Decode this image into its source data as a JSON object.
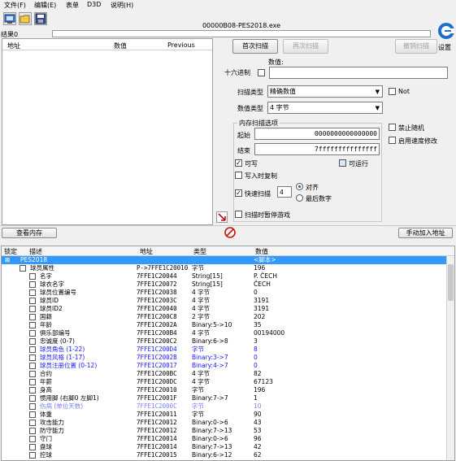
{
  "menu": {
    "file": "文件(F)",
    "edit": "编辑(E)",
    "table": "表单",
    "d3d": "D3D",
    "help": "说明(H)"
  },
  "process_title": "00000B08-PES2018.exe",
  "settings_label": "设置",
  "result_count": "结果0",
  "results_header": {
    "address": "地址",
    "value": "数值",
    "previous": "Previous"
  },
  "buttons": {
    "first_scan": "首次扫描",
    "next_scan": "再次扫描",
    "undo_scan": "撤销扫描",
    "view_memory": "查看内存",
    "add_address": "手动加入地址"
  },
  "scan": {
    "value_label": "数值:",
    "hex_label": "十六进制",
    "scan_type_label": "扫描类型",
    "scan_type_value": "精确数值",
    "not_label": "Not",
    "value_type_label": "数值类型",
    "value_type_value": "4 字节",
    "memory_options_title": "内存扫描选项",
    "start_label": "起始",
    "start_value": "0000000000000000",
    "end_label": "结束",
    "end_value": "7fffffffffffffff",
    "writable_label": "可写",
    "executable_label": "可运行",
    "copy_on_write_label": "写入时复制",
    "fast_scan_label": "快速扫描",
    "fast_scan_value": "4",
    "align_label": "对齐",
    "last_digits_label": "最后数字",
    "pause_label": "扫描时暂停游戏",
    "disable_random_label": "禁止随机",
    "speedhack_label": "启用速度修改"
  },
  "table_header": {
    "active": "锁定",
    "description": "描述",
    "address": "地址",
    "type": "类型",
    "value": "数值"
  },
  "rows": [
    {
      "desc": "PES2018",
      "addr": "",
      "type": "",
      "value": "<脚本>",
      "style": "selected",
      "indent": 0,
      "box": false
    },
    {
      "desc": "球员属性",
      "addr": "P->7FFE1C20010",
      "type": "字节",
      "value": "196",
      "style": "",
      "indent": 1,
      "box": true
    },
    {
      "desc": "名字",
      "addr": "7FFE1C20044",
      "type": "String[15]",
      "value": "P. ČECH",
      "style": "",
      "indent": 2,
      "box": true
    },
    {
      "desc": "球衣名字",
      "addr": "7FFE1C20072",
      "type": "String[15]",
      "value": "ČECH",
      "style": "",
      "indent": 2,
      "box": true
    },
    {
      "desc": "球员位置编号",
      "addr": "7FFE1C20038",
      "type": "4 字节",
      "value": "0",
      "style": "",
      "indent": 2,
      "box": true
    },
    {
      "desc": "球员ID",
      "addr": "7FFE1C2003C",
      "type": "4 字节",
      "value": "3191",
      "style": "",
      "indent": 2,
      "box": true
    },
    {
      "desc": "球员ID2",
      "addr": "7FFE1C20040",
      "type": "4 字节",
      "value": "3191",
      "style": "",
      "indent": 2,
      "box": true
    },
    {
      "desc": "国籍",
      "addr": "7FFE1C200C8",
      "type": "2 字节",
      "value": "202",
      "style": "",
      "indent": 2,
      "box": true
    },
    {
      "desc": "年龄",
      "addr": "7FFE1C2002A",
      "type": "Binary:5->10",
      "value": "35",
      "style": "",
      "indent": 2,
      "box": true
    },
    {
      "desc": "俱乐部编号",
      "addr": "7FFE1C200B4",
      "type": "4 字节",
      "value": "00194000",
      "style": "",
      "indent": 2,
      "box": true
    },
    {
      "desc": "忠诚度 (0-7)",
      "addr": "7FFE1C200C2",
      "type": "Binary:6->8",
      "value": "3",
      "style": "",
      "indent": 2,
      "box": true
    },
    {
      "desc": "球员角色 (1-22)",
      "addr": "7FFE1C200D4",
      "type": "字节",
      "value": "8",
      "style": "blue",
      "indent": 2,
      "box": true
    },
    {
      "desc": "球员风格 (1-17)",
      "addr": "7FFE1C2002B",
      "type": "Binary:3->7",
      "value": "0",
      "style": "blue",
      "indent": 2,
      "box": true
    },
    {
      "desc": "球员注册位置 (0-12)",
      "addr": "7FFE1C20017",
      "type": "Binary:4->7",
      "value": "0",
      "style": "blue",
      "indent": 2,
      "box": true
    },
    {
      "desc": "合约",
      "addr": "7FFE1C200BC",
      "type": "4 字节",
      "value": "82",
      "style": "",
      "indent": 2,
      "box": true
    },
    {
      "desc": "年薪",
      "addr": "7FFE1C200DC",
      "type": "4 字节",
      "value": "67123",
      "style": "",
      "indent": 2,
      "box": true
    },
    {
      "desc": "身高",
      "addr": "7FFE1C20010",
      "type": "字节",
      "value": "196",
      "style": "",
      "indent": 2,
      "box": true
    },
    {
      "desc": "惯用脚 (右脚0 左脚1)",
      "addr": "7FFE1C2001F",
      "type": "Binary:7->7",
      "value": "1",
      "style": "",
      "indent": 2,
      "box": true
    },
    {
      "desc": "伤病 (单位天数)",
      "addr": "7FFE1C2000C",
      "type": "字节",
      "value": "10",
      "style": "lightblue",
      "indent": 2,
      "box": true
    },
    {
      "desc": "体重",
      "addr": "7FFE1C20011",
      "type": "字节",
      "value": "90",
      "style": "",
      "indent": 2,
      "box": true
    },
    {
      "desc": "攻击能力",
      "addr": "7FFE1C20012",
      "type": "Binary:0->6",
      "value": "43",
      "style": "",
      "indent": 2,
      "box": true
    },
    {
      "desc": "防守能力",
      "addr": "7FFE1C20012",
      "type": "Binary:7->13",
      "value": "53",
      "style": "",
      "indent": 2,
      "box": true
    },
    {
      "desc": "守门",
      "addr": "7FFE1C20014",
      "type": "Binary:0->6",
      "value": "96",
      "style": "",
      "indent": 2,
      "box": true
    },
    {
      "desc": "盘球",
      "addr": "7FFE1C20014",
      "type": "Binary:7->13",
      "value": "42",
      "style": "",
      "indent": 2,
      "box": true
    },
    {
      "desc": "控球",
      "addr": "7FFE1C20015",
      "type": "Binary:6->12",
      "value": "62",
      "style": "",
      "indent": 2,
      "box": true
    }
  ],
  "colors": {
    "selected": "#3399ff",
    "blue": "#1a1aff",
    "lightblue": "#8080ff"
  }
}
